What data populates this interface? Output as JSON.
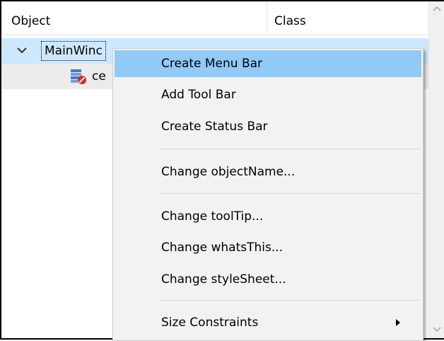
{
  "header": {
    "object_label": "Object",
    "class_label": "Class"
  },
  "tree": {
    "main_window_label": "MainWinc",
    "central_widget_label": "ce",
    "icons": {
      "expand": "chevron-down-icon",
      "widget": "widget-icon"
    }
  },
  "context_menu": {
    "items": [
      {
        "label": "Create Menu Bar",
        "highlighted": true
      },
      {
        "label": "Add Tool Bar"
      },
      {
        "label": "Create Status Bar"
      },
      {
        "label": "Change objectName..."
      },
      {
        "label": "Change toolTip..."
      },
      {
        "label": "Change whatsThis..."
      },
      {
        "label": "Change styleSheet..."
      },
      {
        "label": "Size Constraints",
        "has_submenu": true
      }
    ]
  },
  "colors": {
    "selection": "#cce8ff",
    "menu_highlight": "#91c9f7",
    "menu_background": "#f2f2f2"
  }
}
